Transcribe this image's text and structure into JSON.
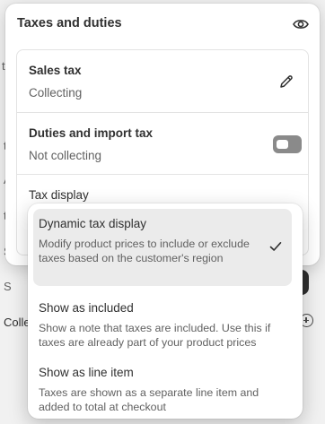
{
  "background": {
    "fragment_a": "t",
    "fragment_b": "A",
    "fragment_c": "t",
    "fragment_d": "S",
    "fragment_e": "S",
    "side_label": "Colle"
  },
  "panel": {
    "title": "Taxes and duties",
    "eye_icon": "eye-icon"
  },
  "sales_tax": {
    "title": "Sales tax",
    "status": "Collecting",
    "edit_icon": "pencil-icon"
  },
  "duties": {
    "title": "Duties and import tax",
    "status": "Not collecting",
    "toggle_on": false
  },
  "tax_display": {
    "label": "Tax display"
  },
  "options": [
    {
      "title": "Dynamic tax display",
      "description": "Modify product prices to include or exclude taxes based on the customer's region",
      "selected": true
    },
    {
      "title": "Show as included",
      "description": "Show a note that taxes are included. Use this if taxes are already part of your product prices",
      "selected": false
    },
    {
      "title": "Show as line item",
      "description": "Taxes are shown as a separate line item and added to total at checkout",
      "selected": false
    }
  ],
  "colors": {
    "accent_dark": "#303030",
    "toggle_off": "#8a8a8a",
    "selected_bg": "#ebebeb"
  }
}
